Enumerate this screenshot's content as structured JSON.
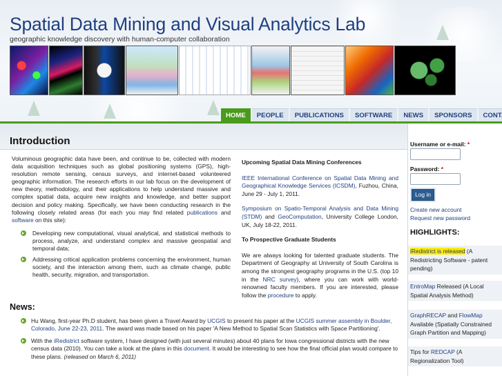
{
  "header": {
    "title": "Spatial Data Mining and Visual Analytics Lab",
    "tagline": "geographic knowledge discovery with human-computer collaboration"
  },
  "nav": {
    "items": [
      "HOME",
      "PEOPLE",
      "PUBLICATIONS",
      "SOFTWARE",
      "NEWS",
      "SPONSORS",
      "CONTACT"
    ],
    "active": "HOME"
  },
  "intro": {
    "title": "Introduction",
    "paragraph_pre": "Voluminous geographic data have been, and continue to be, collected with modern data acquisition techniques such as global positioning systems (GPS), high-resolution remote sensing, census surveys, and internet-based volunteered geographic information. The research efforts in our lab focus on the development of new theory, methodology, and their applications to help understand massive and complex spatial data, acquire new insights and knowledge, and better support decision and policy making. Specifically, we have been conducting research in the following closely related areas (for each you may find related ",
    "link_publications": "publications",
    "and_text": " and ",
    "link_software": "software",
    "paragraph_post": " on this site):",
    "bullets": [
      "Developing new computational, visual analytical, and statistical methods to process, analyze, and understand complex and massive geospatial and temporal data;",
      "Addressing critical application problems concerning the environment, human society, and the interaction among them, such as climate change, public health, security, migration, and transportation."
    ]
  },
  "conferences": {
    "heading": "Upcoming Spatial Data Mining Conferences",
    "items": [
      {
        "link": "IEEE International Conference on Spatial Data Mining and Geographical Knowledge Services (ICSDM)",
        "rest": ", Fuzhou, China, June 29 - July 1, 2011."
      },
      {
        "link": "Symposium on Spatio-Temporal Analysis and Data Mining (STDM)",
        "mid": " and ",
        "link2": "GeoComputation",
        "rest": ", University College London, UK, July 18-22, 2011."
      }
    ]
  },
  "graduate": {
    "heading": "To Prospective Graduate Students",
    "text_pre": "We are always looking for talented graduate students. The Department of Geography at University of South Carolina is among the strongest geography programs in the U.S. (top 10 in the ",
    "link_nrc": "NRC survey",
    "text_mid": "), where you can work with world-renowned faculty members. If you are interested, please follow the ",
    "link_procedure": "procedure",
    "text_post": " to apply."
  },
  "news": {
    "title": "News:",
    "item1_pre": "Hu Wang, first-year Ph.D student, has been given a Travel Award by ",
    "item1_link1": "UCGIS",
    "item1_mid1": " to present his paper at the ",
    "item1_link2": "UCGIS summer assembly in Boulder, Colorado, June 22-23, 2011",
    "item1_post": ". The award was made based on his paper 'A New Method to Spatial Scan Statistics with Space Partitioning'.",
    "item2_pre": "With the ",
    "item2_link1": "iRedistrict",
    "item2_mid": " software system, I have designed (with just several minutes) about 40 plans for Iowa congressional districts with the new census data (2010). You can take a look at the plans in this ",
    "item2_link2": "document",
    "item2_post": ". It would be interesting to see how the final official plan would compare to these plans.",
    "item2_date": "(released on March 6, 2011)"
  },
  "sidebar": {
    "username_label": "Username or e-mail:",
    "password_label": "Password:",
    "required_mark": "*",
    "login_button": "Log in",
    "create_account": "Create new account",
    "request_password": "Request new password",
    "highlights_title": "HIGHLIGHTS:",
    "highlights": [
      {
        "link": "iRedistrict is released",
        "rest": " (A Redistricting Software - patent pending)"
      },
      {
        "link": "EntroMap",
        "rest": " Released (A Local Spatial Analysis Method)"
      },
      {
        "link": "GraphRECAP",
        "mid": " and ",
        "link2": "FlowMap",
        "rest": " Available (Spatially Constrained Graph Partition and Mapping)"
      },
      {
        "pre": "Tips for ",
        "link": "REDCAP",
        "rest": " (A Regionalization Tool)"
      }
    ]
  },
  "colors": {
    "title_blue": "#1f3f80",
    "nav_active_green": "#4a9b1c",
    "highlight_yellow": "#ffea00"
  }
}
